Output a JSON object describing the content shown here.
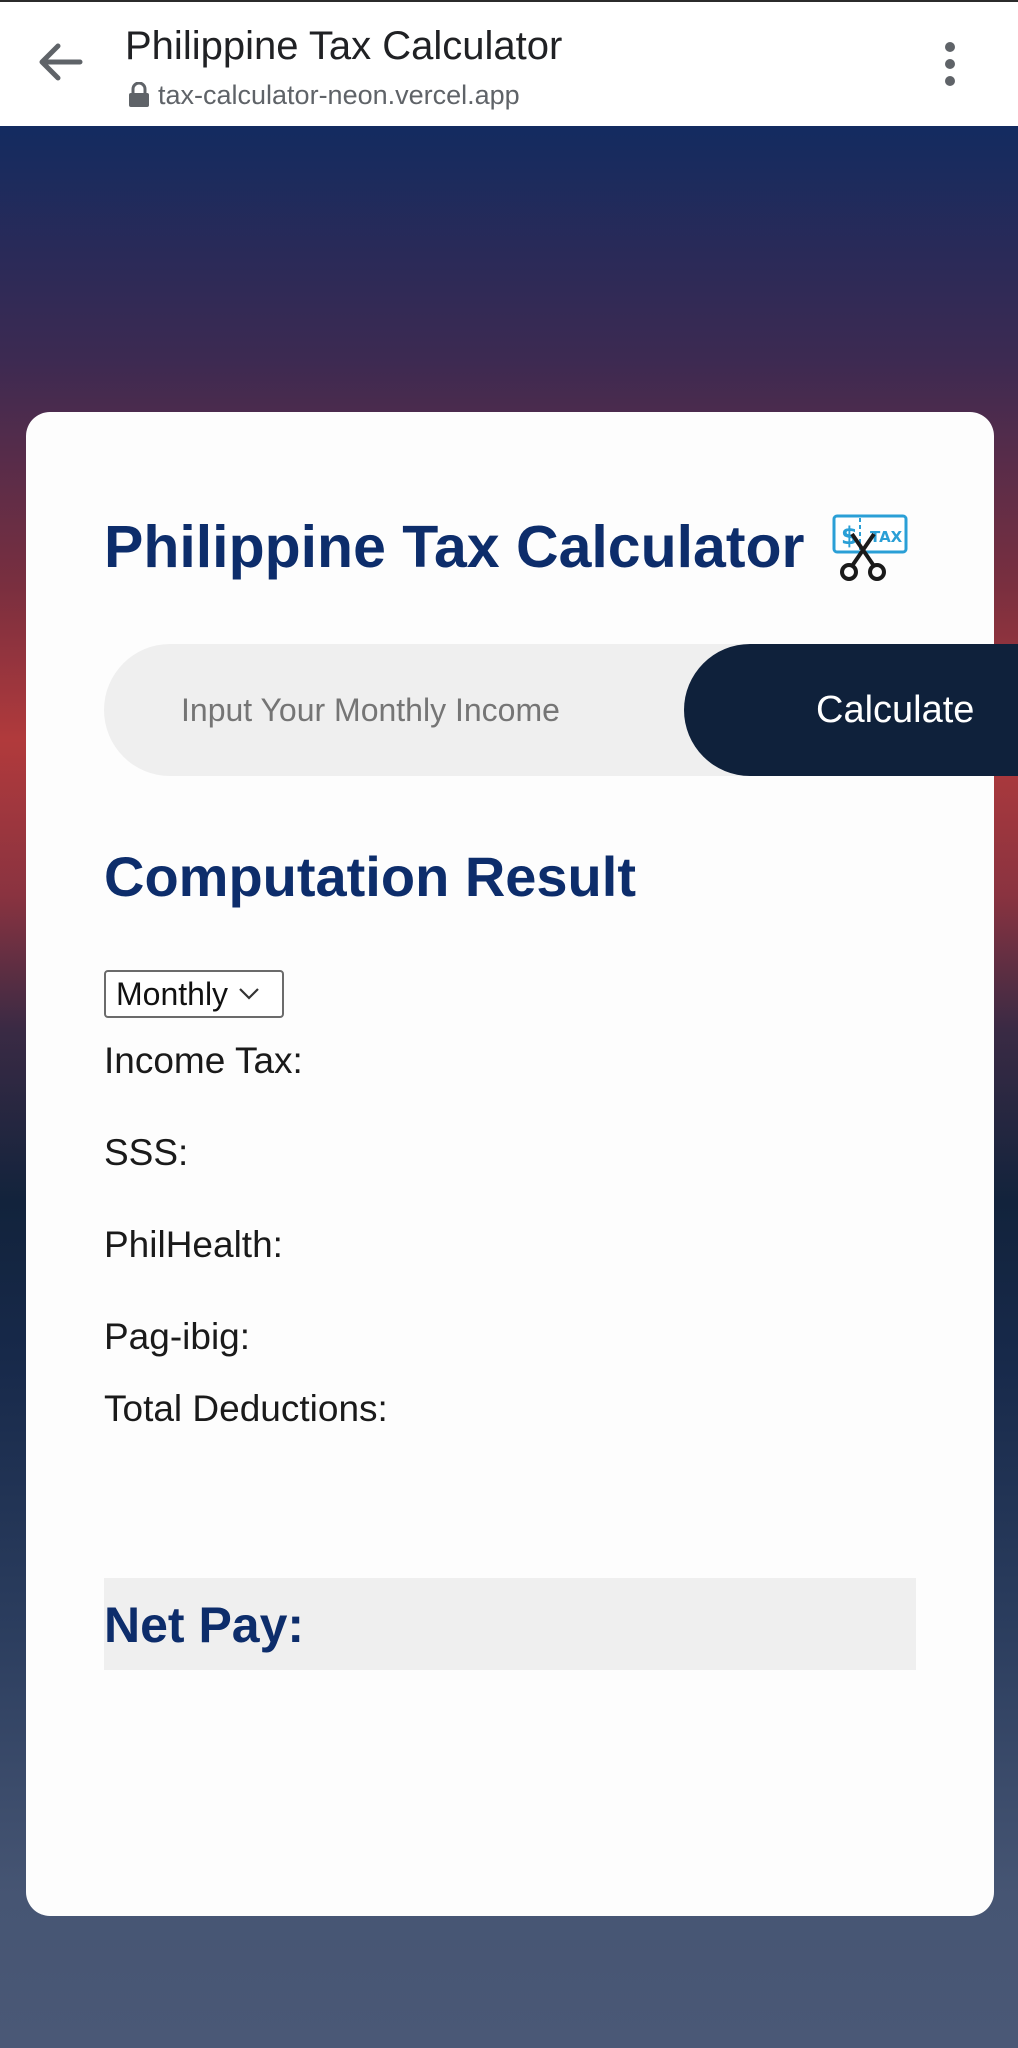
{
  "browser": {
    "title": "Philippine Tax Calculator",
    "url": "tax-calculator-neon.vercel.app",
    "back_icon": "arrow-left-icon",
    "lock_icon": "lock-icon",
    "menu_icon": "more-vertical-icon"
  },
  "app": {
    "title": "Philippine Tax Calculator",
    "title_icon": "tax-scissors-icon",
    "title_icon_text": "TAX",
    "income_input": {
      "placeholder": "Input Your Monthly Income",
      "value": ""
    },
    "calculate_label": "Calculate",
    "section_title": "Computation Result",
    "period_select": {
      "selected": "Monthly"
    },
    "results": {
      "income_tax": "Income Tax:",
      "sss": "SSS:",
      "philhealth": "PhilHealth:",
      "pagibig": "Pag-ibig:",
      "total_deductions": "Total Deductions:"
    },
    "net_pay_label": "Net Pay:"
  },
  "colors": {
    "title_blue": "#0d2d6b",
    "button_navy": "#0f213b",
    "input_gray": "#efefef",
    "gradient_top": "#132b60",
    "gradient_red": "#b13a3c",
    "gradient_bottom": "#4a5876"
  }
}
